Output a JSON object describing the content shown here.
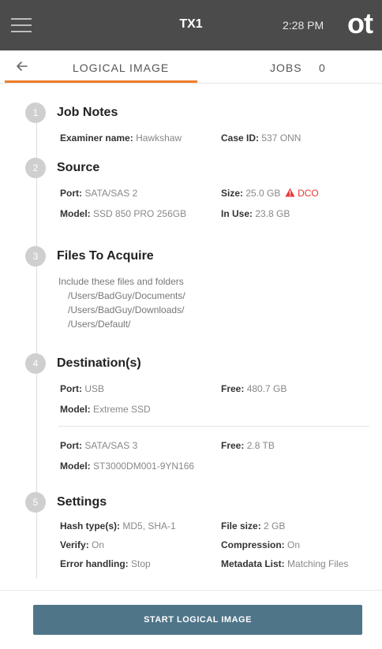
{
  "header": {
    "device": "TX1",
    "time": "2:28 PM",
    "logo": "ot"
  },
  "tabs": {
    "logical_image": "LOGICAL IMAGE",
    "jobs": "JOBS",
    "jobs_count": "0"
  },
  "sections": {
    "job_notes": {
      "number": "1",
      "title": "Job Notes",
      "examiner_label": "Examiner name:",
      "examiner_value": "Hawkshaw",
      "case_label": "Case ID:",
      "case_value": "537 ONN"
    },
    "source": {
      "number": "2",
      "title": "Source",
      "port_label": "Port:",
      "port_value": "SATA/SAS 2",
      "size_label": "Size:",
      "size_value": "25.0 GB",
      "dco": "DCO",
      "model_label": "Model:",
      "model_value": "SSD 850 PRO 256GB",
      "inuse_label": "In Use:",
      "inuse_value": "23.8 GB"
    },
    "files": {
      "number": "3",
      "title": "Files To Acquire",
      "intro": "Include these files and folders",
      "paths": [
        "/Users/BadGuy/Documents/",
        "/Users/BadGuy/Downloads/",
        "/Users/Default/"
      ]
    },
    "destinations": {
      "number": "4",
      "title": "Destination(s)",
      "items": [
        {
          "port_label": "Port:",
          "port": "USB",
          "free_label": "Free:",
          "free": "480.7 GB",
          "model_label": "Model:",
          "model": "Extreme SSD"
        },
        {
          "port_label": "Port:",
          "port": "SATA/SAS 3",
          "free_label": "Free:",
          "free": "2.8 TB",
          "model_label": "Model:",
          "model": "ST3000DM001-9YN166"
        }
      ]
    },
    "settings": {
      "number": "5",
      "title": "Settings",
      "hash_label": "Hash type(s):",
      "hash_value": "MD5, SHA-1",
      "filesize_label": "File size:",
      "filesize_value": "2 GB",
      "verify_label": "Verify:",
      "verify_value": "On",
      "compression_label": "Compression:",
      "compression_value": "On",
      "error_label": "Error handling:",
      "error_value": "Stop",
      "metadata_label": "Metadata List:",
      "metadata_value": "Matching Files"
    }
  },
  "footer": {
    "start_button": "START LOGICAL IMAGE"
  },
  "colors": {
    "accent": "#f07d2b",
    "button": "#4f7589",
    "warning": "#e53935",
    "topbar": "#4b4b4b"
  },
  "icons": [
    "menu-icon",
    "back-arrow-icon",
    "warning-icon"
  ]
}
